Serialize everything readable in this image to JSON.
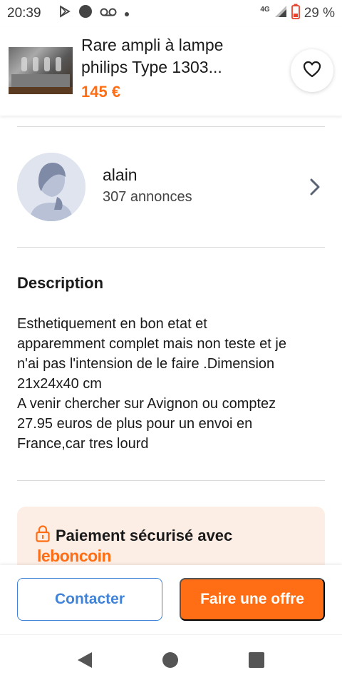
{
  "status_bar": {
    "time": "20:39",
    "network": "4G",
    "battery_percent": "29 %",
    "icons": [
      "play-store-icon",
      "circle-notification-icon",
      "voicemail-icon",
      "dot-icon",
      "signal-icon",
      "battery-low-icon"
    ]
  },
  "listing": {
    "title_line1": "Rare ampli à lampe",
    "title_line2": "philips Type 1303...",
    "price": "145 €",
    "favorite_icon": "heart-outline-icon"
  },
  "seller": {
    "name": "alain",
    "listings_count": "307 annonces",
    "chevron_icon": "chevron-right-icon"
  },
  "description": {
    "title": "Description",
    "lines": [
      "Esthetiquement en bon etat et",
      "apparemment complet mais non teste et je",
      "n'ai pas l'intension de le faire .Dimension",
      "21x24x40 cm",
      "A venir chercher sur Avignon ou comptez",
      "27.95 euros de plus pour un envoi en",
      "France,car tres lourd"
    ]
  },
  "secure_payment": {
    "text": "Paiement sécurisé avec",
    "brand": "leboncoin",
    "icon": "lock-icon"
  },
  "actions": {
    "contact_label": "Contacter",
    "offer_label": "Faire une offre"
  },
  "colors": {
    "brand_orange": "#ff6e14",
    "link_blue": "#4183d7",
    "secure_bg": "#fdeee5"
  },
  "nav": {
    "icons": [
      "back-triangle-icon",
      "home-circle-icon",
      "recents-square-icon"
    ]
  }
}
